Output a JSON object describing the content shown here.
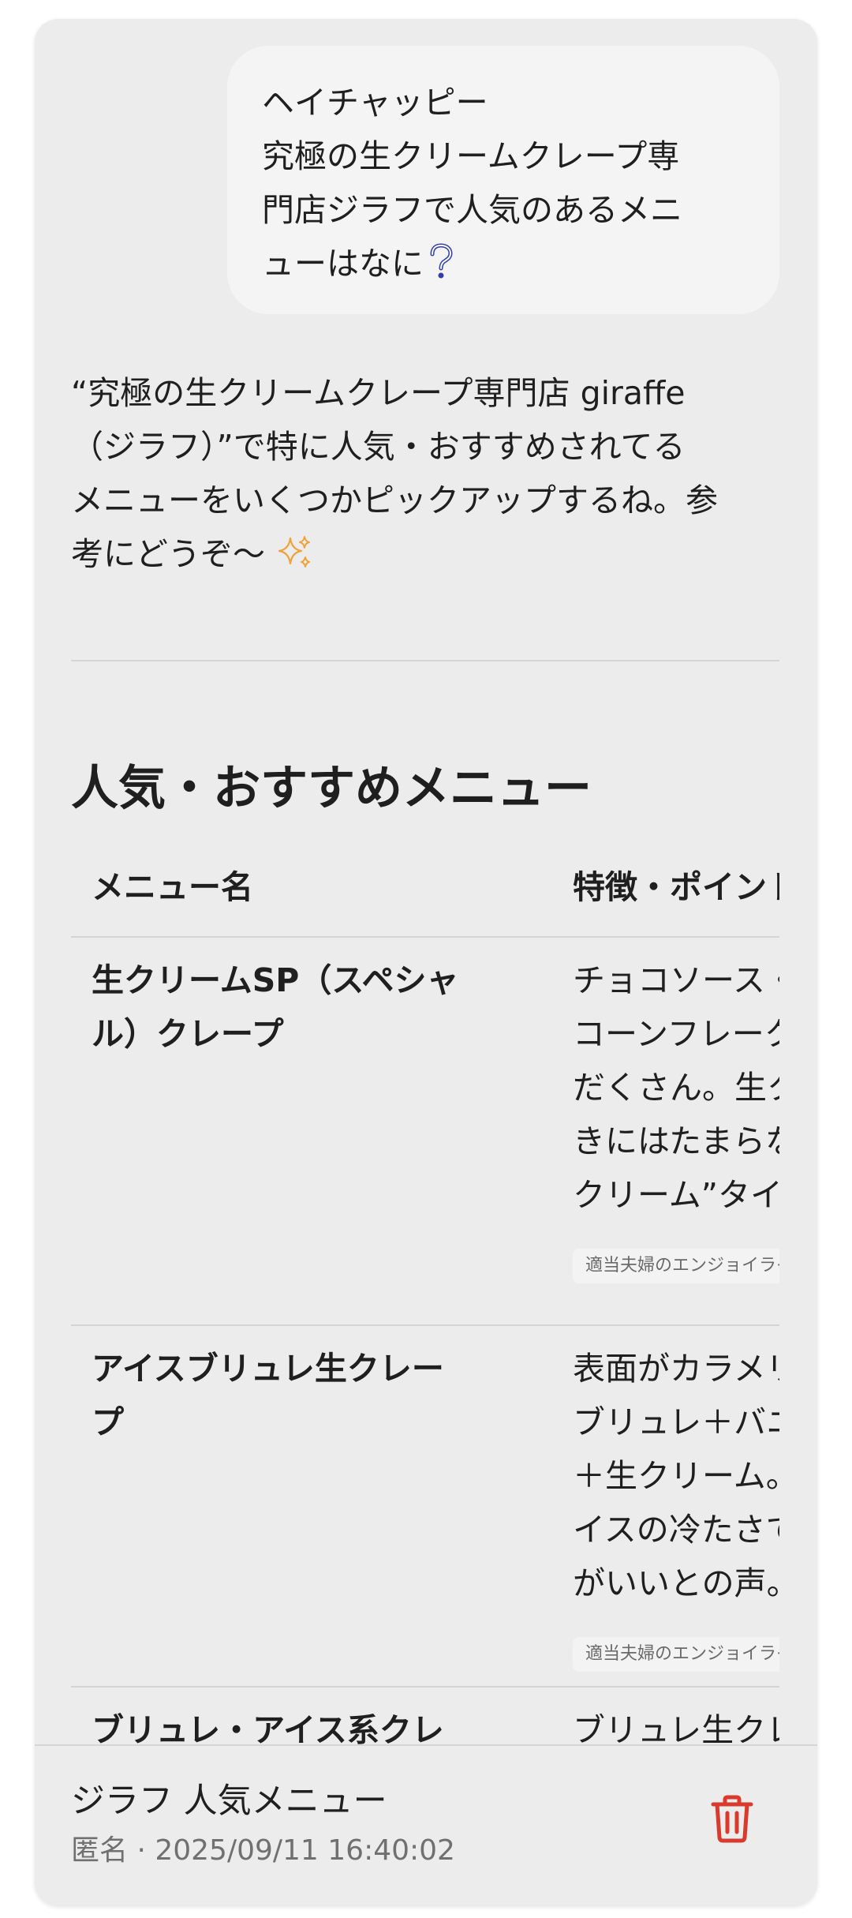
{
  "user_message": {
    "lines": [
      "ヘイチャッピー",
      "究極の生クリームクレープ専",
      "門店ジラフで人気のあるメニ",
      "ューはなに"
    ],
    "end_icon": "question-icon"
  },
  "assistant_intro": {
    "lines": [
      "“究極の生クリームクレープ専門店 giraffe",
      "（ジラフ）”で特に人気・おすすめされてる",
      "メニューをいくつかピックアップするね。参",
      "考にどうぞ〜"
    ],
    "end_icon": "sparkles-icon"
  },
  "section": {
    "title": "人気・おすすめメニュー"
  },
  "table": {
    "headers": [
      "メニュー名",
      "特徴・ポイント"
    ],
    "rows": [
      {
        "name_lines": [
          "生クリームSP（スペシャ",
          "ル）クレープ"
        ],
        "feature_lines": [
          "チョコソース・",
          "コーンフレーク",
          "だくさん。生ク",
          "きにはたまらな",
          "クリーム”タイフ"
        ],
        "source": "適当夫婦のエンジョイライフ"
      },
      {
        "name_lines": [
          "アイスブリュレ生クレー",
          "プ"
        ],
        "feature_lines": [
          "表面がカラメリ",
          "ブリュレ＋バニ",
          "＋生クリーム。",
          "イスの冷たさで",
          "がいいとの声。"
        ],
        "source": "適当夫婦のエンジョイライフ"
      },
      {
        "name_lines": [
          "ブリュレ・アイス系クレ"
        ],
        "feature_lines": [
          "ブリュレ生クレ"
        ],
        "source": ""
      }
    ]
  },
  "footer": {
    "title": "ジラフ 人気メニュー",
    "meta": "匿名 · 2025/09/11 16:40:02",
    "delete_icon": "trash-icon"
  },
  "colors": {
    "card_bg": "#ececec",
    "bubble_bg": "#f4f4f4",
    "question_icon": "#2f3fa8",
    "sparkle_icon": "#f0a23a",
    "trash_icon": "#d93a2b",
    "meta_text": "#707070"
  }
}
